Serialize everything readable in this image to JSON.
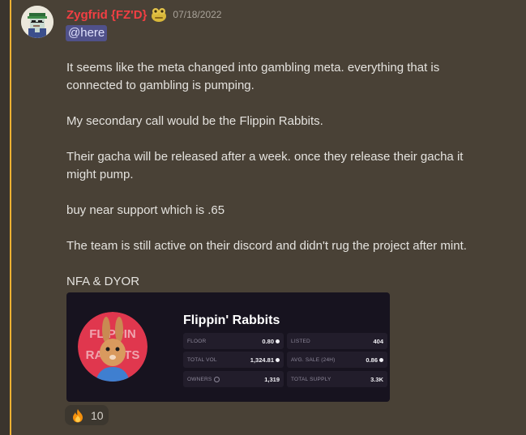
{
  "message": {
    "author": {
      "name": "Zygfrid {FZ'D}",
      "role_icon": "pepe-badge-icon",
      "avatar_icon": "pixel-art-avatar-icon"
    },
    "timestamp": "07/18/2022",
    "mention": "@here",
    "paragraphs": [
      "It seems like the meta changed into gambling meta. everything that is",
      "connected to gambling is pumping.",
      "My secondary call would be the Flippin Rabbits.",
      "Their gacha will be released after a week. once they release their gacha it",
      "might pump.",
      "buy near support which is .65",
      "The team is still active on their discord and didn't rug the project after mint.",
      "NFA & DYOR"
    ]
  },
  "embed_card": {
    "title": "Flippin' Rabbits",
    "logo_icon": "flippin-rabbits-logo-icon",
    "stats": [
      {
        "label": "FLOOR",
        "value": "0.80",
        "currency_icon": true
      },
      {
        "label": "LISTED",
        "value": "404",
        "currency_icon": false
      },
      {
        "label": "TOTAL VOL",
        "value": "1,324.81",
        "currency_icon": true
      },
      {
        "label": "AVG. SALE (24h)",
        "value": "0.86",
        "currency_icon": true
      },
      {
        "label": "OWNERS",
        "value": "1,319",
        "currency_icon": false,
        "info_icon": true
      },
      {
        "label": "TOTAL SUPPLY",
        "value": "3.3K",
        "currency_icon": false
      }
    ]
  },
  "reaction": {
    "emoji_icon": "fire-icon",
    "count": "10"
  },
  "colors": {
    "username": "#f23f43",
    "highlight_bar": "#f0b132",
    "background": "#494136",
    "mention_bg": "#5865f2"
  }
}
